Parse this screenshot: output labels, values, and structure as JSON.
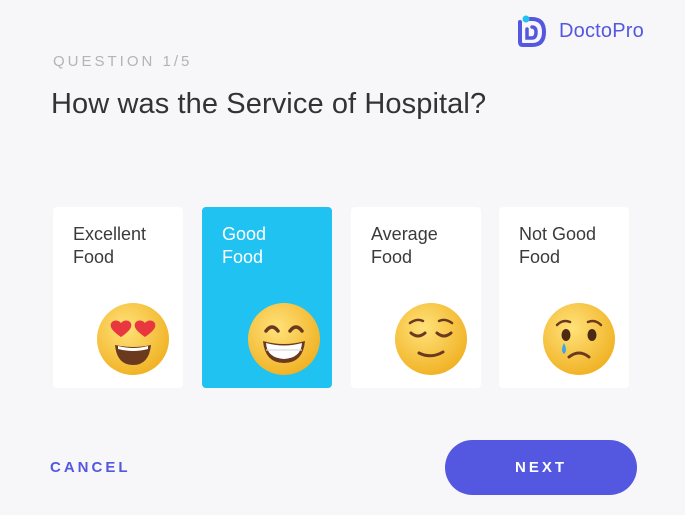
{
  "brand": {
    "name": "DoctoPro",
    "color": "#5457e0"
  },
  "question": {
    "counter": "QUESTION 1/5",
    "title": "How was the Service of Hospital?"
  },
  "options": [
    {
      "line1": "Excellent",
      "line2": "Food",
      "icon": "heart-eyes-emoji-icon",
      "selected": false
    },
    {
      "line1": "Good",
      "line2": "Food",
      "icon": "grinning-emoji-icon",
      "selected": true
    },
    {
      "line1": "Average",
      "line2": "Food",
      "icon": "relieved-emoji-icon",
      "selected": false
    },
    {
      "line1": "Not Good",
      "line2": "Food",
      "icon": "sad-tear-emoji-icon",
      "selected": false
    }
  ],
  "actions": {
    "cancel_label": "CANCEL",
    "next_label": "NEXT"
  },
  "colors": {
    "accent": "#5457e0",
    "selected_card": "#1fc2f0",
    "emoji_yellow": "#f6c531"
  }
}
